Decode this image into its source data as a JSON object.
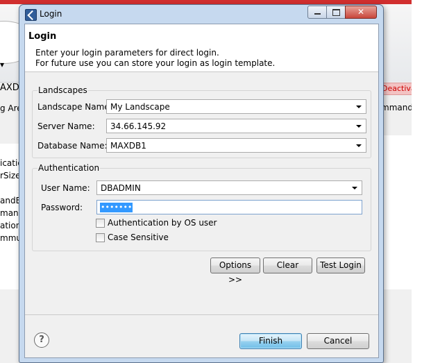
{
  "background": {
    "left_texts": [
      "▾",
      "AXD",
      "g Are",
      "ication",
      "rSize",
      "andB",
      "mand",
      "ation",
      "mmu"
    ],
    "right_status": "Deactivated",
    "right_cmd": "mmand L"
  },
  "dialog": {
    "window_title": "Login",
    "header_title": "Login",
    "header_line1": "Enter your login parameters for direct login.",
    "header_line2": "For future use you can store your login as login template.",
    "landscapes": {
      "group_label": "Landscapes",
      "landscape_name_label": "Landscape Name:",
      "landscape_name_value": "My Landscape",
      "server_name_label": "Server Name:",
      "server_name_value": "34.66.145.92",
      "database_name_label": "Database Name:",
      "database_name_value": "MAXDB1"
    },
    "authentication": {
      "group_label": "Authentication",
      "user_name_label": "User Name:",
      "user_name_value": "DBADMIN",
      "password_label": "Password:",
      "password_value": "•••••••",
      "os_user_label": "Authentication by OS user",
      "case_sensitive_label": "Case Sensitive"
    },
    "buttons": {
      "options": "Options >>",
      "clear": "Clear",
      "test_login": "Test Login",
      "finish": "Finish",
      "cancel": "Cancel"
    },
    "help_glyph": "?"
  }
}
